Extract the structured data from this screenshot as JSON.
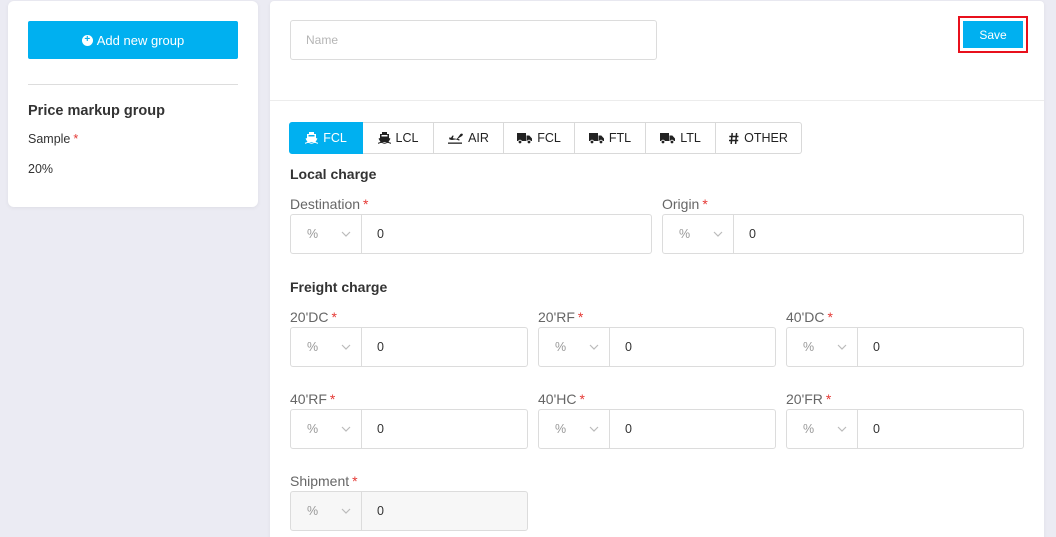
{
  "sidebar": {
    "add_button_label": "Add new group",
    "group_title": "Price markup group",
    "group_name": "Sample",
    "required_mark": "*",
    "group_value": "20%"
  },
  "header": {
    "name_placeholder": "Name",
    "save_label": "Save"
  },
  "tabs": [
    {
      "label": "FCL",
      "icon": "ship-icon",
      "active": true
    },
    {
      "label": "LCL",
      "icon": "ship-icon",
      "active": false
    },
    {
      "label": "AIR",
      "icon": "plane-icon",
      "active": false
    },
    {
      "label": "FCL",
      "icon": "truck-icon",
      "active": false
    },
    {
      "label": "FTL",
      "icon": "truck-icon",
      "active": false
    },
    {
      "label": "LTL",
      "icon": "truck-icon",
      "active": false
    },
    {
      "label": "OTHER",
      "icon": "hash-icon",
      "active": false
    }
  ],
  "local_charge": {
    "title": "Local charge",
    "fields": [
      {
        "label": "Destination",
        "unit": "%",
        "value": "0"
      },
      {
        "label": "Origin",
        "unit": "%",
        "value": "0"
      }
    ]
  },
  "freight_charge": {
    "title": "Freight charge",
    "fields": [
      {
        "label": "20'DC",
        "unit": "%",
        "value": "0"
      },
      {
        "label": "20'RF",
        "unit": "%",
        "value": "0"
      },
      {
        "label": "40'DC",
        "unit": "%",
        "value": "0"
      },
      {
        "label": "40'RF",
        "unit": "%",
        "value": "0"
      },
      {
        "label": "40'HC",
        "unit": "%",
        "value": "0"
      },
      {
        "label": "20'FR",
        "unit": "%",
        "value": "0"
      },
      {
        "label": "Shipment",
        "unit": "%",
        "value": "0"
      }
    ]
  },
  "colors": {
    "accent": "#00b0f0",
    "required": "#e53935",
    "highlight": "#e8101c"
  }
}
